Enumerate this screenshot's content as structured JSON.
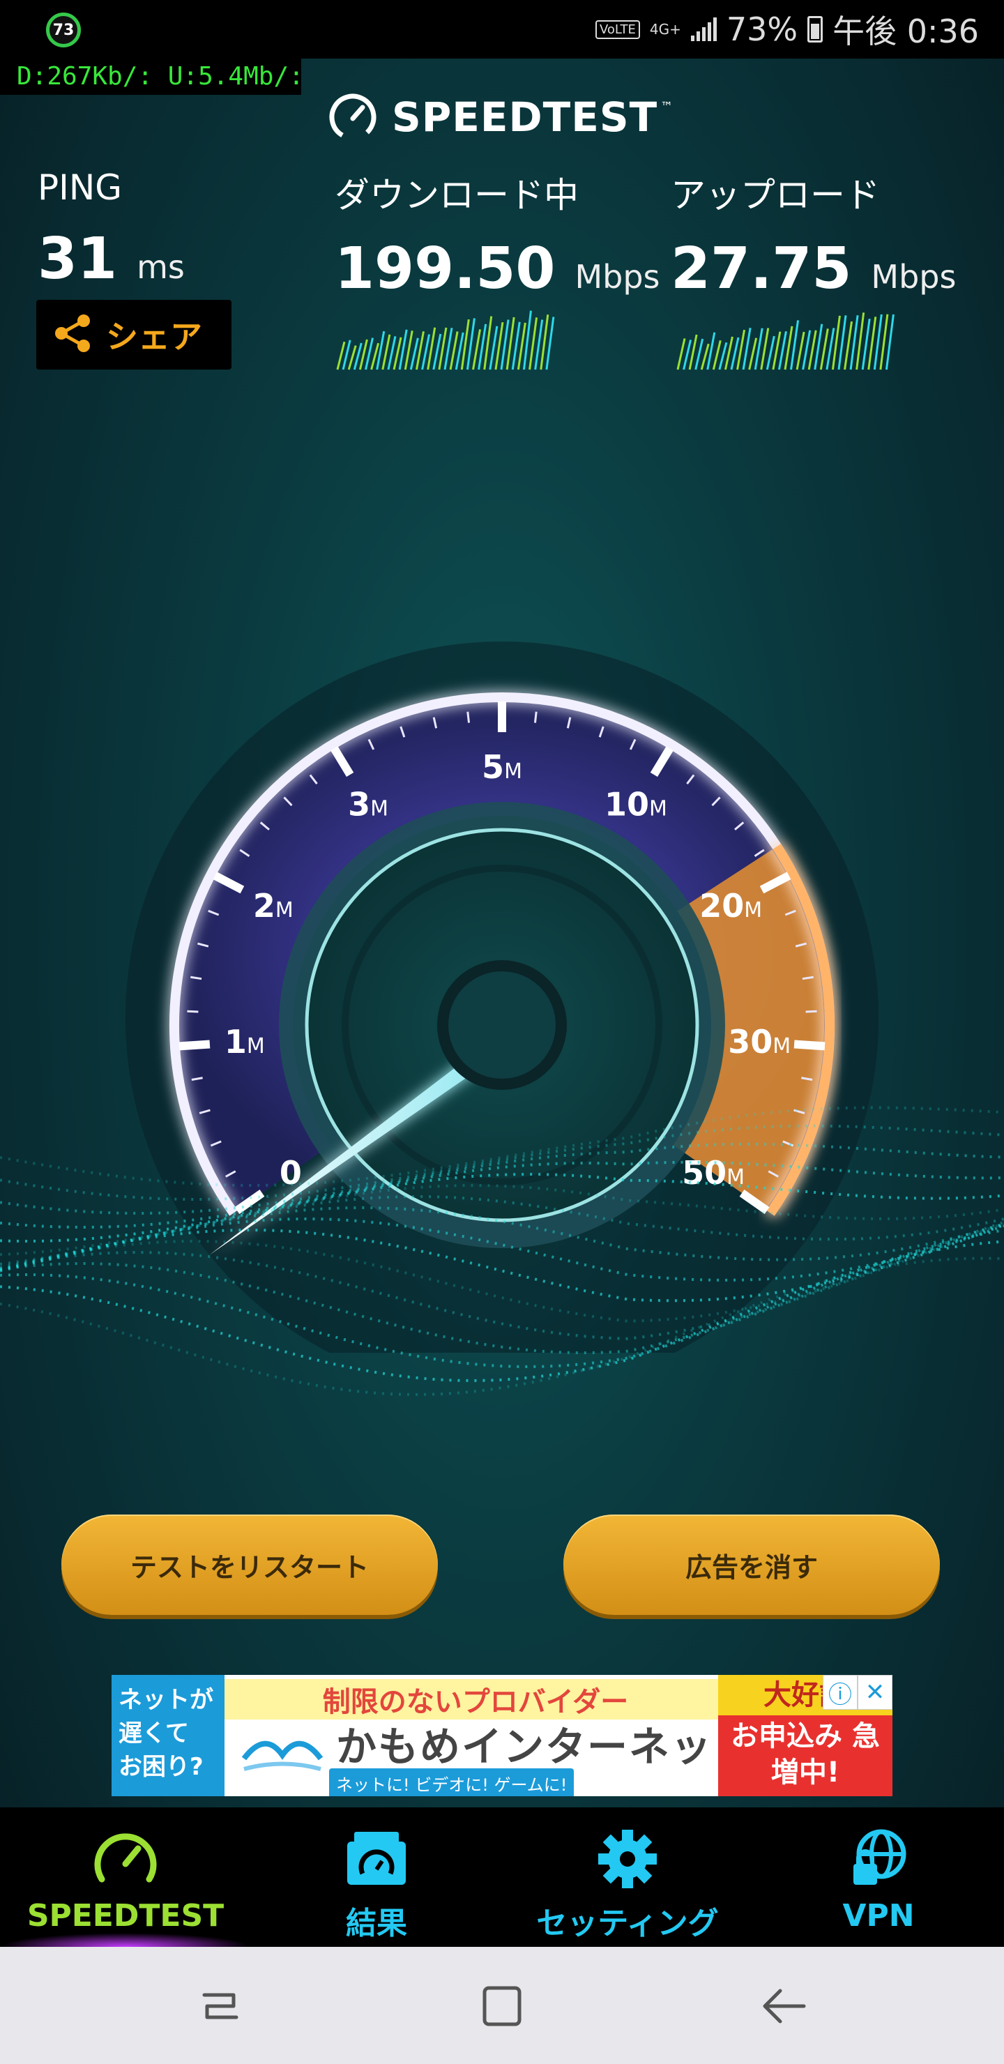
{
  "status_bar": {
    "badge": "73",
    "volte": "VoLTE",
    "network": "4G+",
    "battery": "73%",
    "time": "午後 0:36"
  },
  "net_overlay": "D:267Kb/: U:5.4Mb/:",
  "brand": {
    "name": "SPEEDTEST",
    "tm": "™"
  },
  "stats": {
    "ping": {
      "label": "PING",
      "value": "31",
      "unit": "ms"
    },
    "download": {
      "label": "ダウンロード中",
      "value": "199.50",
      "unit": "Mbps"
    },
    "upload": {
      "label": "アップロード",
      "value": "27.75",
      "unit": "Mbps"
    }
  },
  "share": {
    "label": "シェア",
    "icon": "share-icon"
  },
  "gauge": {
    "ticks": [
      {
        "num": "0",
        "unit": ""
      },
      {
        "num": "1",
        "unit": "M"
      },
      {
        "num": "2",
        "unit": "M"
      },
      {
        "num": "3",
        "unit": "M"
      },
      {
        "num": "5",
        "unit": "M"
      },
      {
        "num": "10",
        "unit": "M"
      },
      {
        "num": "20",
        "unit": "M"
      },
      {
        "num": "30",
        "unit": "M"
      },
      {
        "num": "50",
        "unit": "M"
      }
    ]
  },
  "buttons": {
    "restart": "テストをリスタート",
    "remove_ads": "広告を消す"
  },
  "ad": {
    "left": "ネットが 遅くて お困り?",
    "top": "制限のないプロバイダー",
    "main": "かもめインターネット",
    "sub": "ネットに! ビデオに! ゲームに!",
    "badge": "大好評",
    "cta": "お申込み 急増中!",
    "info_icon": "info-icon",
    "close_icon": "close-icon"
  },
  "nav": [
    {
      "label": "SPEEDTEST",
      "icon": "speedometer-icon",
      "active": true
    },
    {
      "label": "結果",
      "icon": "results-icon",
      "active": false
    },
    {
      "label": "セッティング",
      "icon": "gear-icon",
      "active": false
    },
    {
      "label": "VPN",
      "icon": "vpn-icon",
      "active": false
    }
  ],
  "colors": {
    "accent_green": "#9be032",
    "accent_cyan": "#23c9f2",
    "button_gold": "#f2b636",
    "gauge_orange": "#e8902f"
  }
}
